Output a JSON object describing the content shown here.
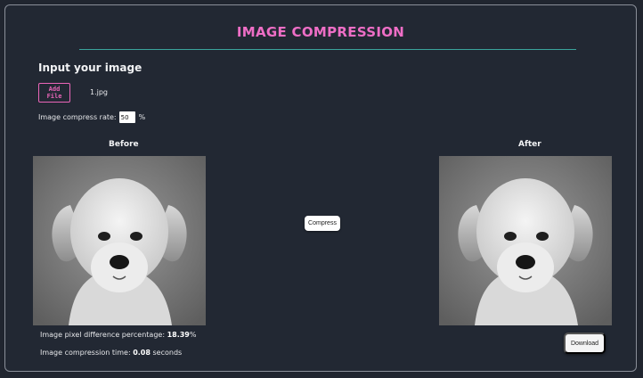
{
  "header": {
    "title": "IMAGE COMPRESSION"
  },
  "input_section": {
    "heading": "Input your image",
    "add_file_label": "Add File",
    "file_name": "1.jpg",
    "rate_label": "Image compress rate:",
    "rate_value": "50",
    "rate_unit": "%"
  },
  "panes": {
    "before_label": "Before",
    "after_label": "After"
  },
  "actions": {
    "compress_label": "Compress",
    "download_label": "Download"
  },
  "stats": {
    "pixel_diff_label": "Image pixel difference percentage:",
    "pixel_diff_value": "18.39",
    "pixel_diff_unit": "%",
    "time_label": "Image compression time:",
    "time_value": "0.08",
    "time_unit": "seconds"
  },
  "colors": {
    "background": "#20252f",
    "title_accent": "#ee6ec6",
    "rule_accent": "#3aa49c",
    "button_outline": "#ea65b8"
  }
}
